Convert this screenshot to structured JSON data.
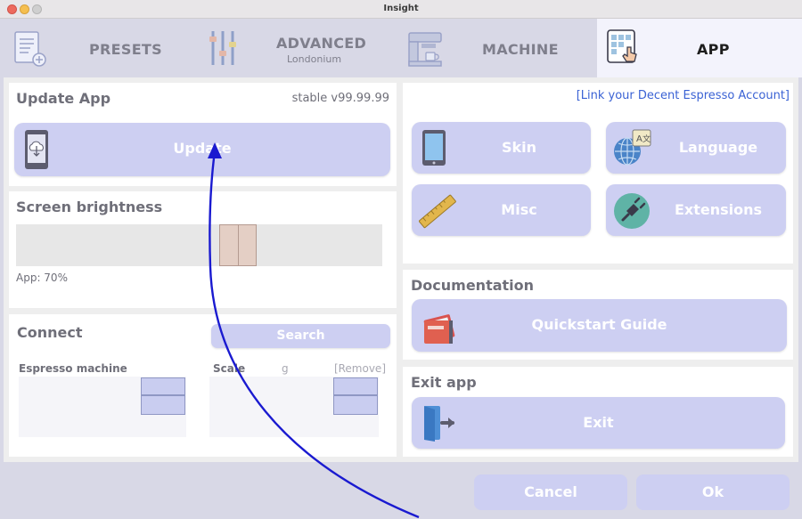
{
  "window": {
    "title": "Insight"
  },
  "tabs": [
    {
      "label": "PRESETS",
      "sublabel": ""
    },
    {
      "label": "ADVANCED",
      "sublabel": "Londonium"
    },
    {
      "label": "MACHINE",
      "sublabel": ""
    },
    {
      "label": "APP",
      "sublabel": ""
    }
  ],
  "update_panel": {
    "title": "Update App",
    "version": "stable v99.99.99",
    "button_label": "Update"
  },
  "brightness_panel": {
    "title": "Screen brightness",
    "value_label": "App: 70%",
    "slider_value": 0.7
  },
  "connect_panel": {
    "title": "Connect",
    "search_label": "Search",
    "espresso_label": "Espresso machine",
    "scale_label": "Scale",
    "scale_unit": "g",
    "remove_label": "[Remove]"
  },
  "account_link": "[Link your Decent Espresso Account]",
  "settings_buttons": {
    "skin": "Skin",
    "language": "Language",
    "misc": "Misc",
    "extensions": "Extensions"
  },
  "documentation": {
    "title": "Documentation",
    "button_label": "Quickstart Guide"
  },
  "exit_panel": {
    "title": "Exit app",
    "button_label": "Exit"
  },
  "footer": {
    "cancel_label": "Cancel",
    "ok_label": "Ok"
  },
  "colors": {
    "accent_button": "#cdcff2",
    "active_tab": "#f3f3fc",
    "link": "#3a62d4",
    "annotation_arrow": "#1a1ad0"
  }
}
